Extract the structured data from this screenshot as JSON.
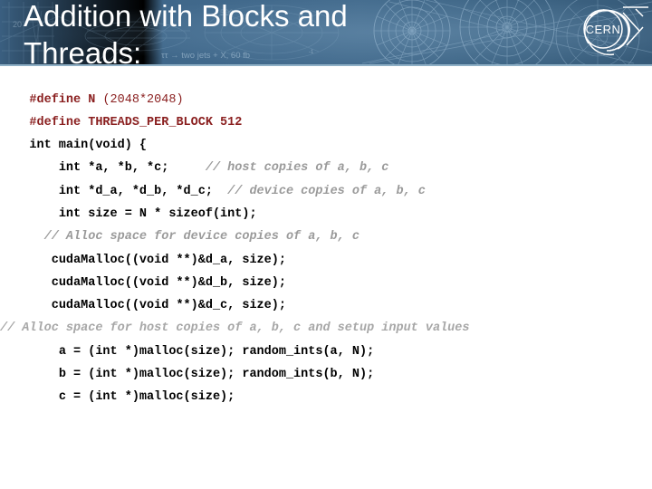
{
  "slide": {
    "title_line_1": "Addition with Blocks and",
    "title_line_2": "Threads:",
    "background_color": "#ffffff",
    "banner_color": "#3e6383",
    "banner_underline_color": "#8fb0c6",
    "title_color": "#ffffff"
  },
  "logo": {
    "name": "cern-logo",
    "text": "CERN",
    "color": "#ffffff"
  },
  "banner_art": {
    "faint_text": "ττ → two jets + X, 60 fb",
    "faint_number": "20"
  },
  "code": {
    "language": "cuda-c",
    "define_color": "#8a1f1f",
    "comment_color": "#9a9a9a",
    "keyword_color": "#000000",
    "lines": [
      {
        "id": "line-1",
        "segments": [
          {
            "text": "    ",
            "style": "plain"
          },
          {
            "text": "#define",
            "style": "red-b"
          },
          {
            "text": " ",
            "style": "plain"
          },
          {
            "text": "N",
            "style": "red-b"
          },
          {
            "text": " (2048*2048)",
            "style": "red"
          }
        ]
      },
      {
        "id": "line-2",
        "segments": [
          {
            "text": "    ",
            "style": "plain"
          },
          {
            "text": "#define",
            "style": "red-b"
          },
          {
            "text": " ",
            "style": "plain"
          },
          {
            "text": "THREADS_PER_BLOCK 512",
            "style": "red-b"
          }
        ]
      },
      {
        "id": "line-3",
        "segments": [
          {
            "text": "    ",
            "style": "plain"
          },
          {
            "text": "int main(void) {",
            "style": "kw"
          }
        ]
      },
      {
        "id": "line-4",
        "segments": [
          {
            "text": "        ",
            "style": "plain"
          },
          {
            "text": "int *a, *b, *c;",
            "style": "kw"
          },
          {
            "text": "     ",
            "style": "plain"
          },
          {
            "text": "// host copies of a, b, c",
            "style": "cmt"
          }
        ]
      },
      {
        "id": "line-5",
        "segments": [
          {
            "text": "        ",
            "style": "plain"
          },
          {
            "text": "int *d_a, *d_b, *d_c;",
            "style": "kw"
          },
          {
            "text": "  ",
            "style": "plain"
          },
          {
            "text": "// device copies of a, b, c",
            "style": "cmt"
          }
        ]
      },
      {
        "id": "line-6",
        "segments": [
          {
            "text": "        ",
            "style": "plain"
          },
          {
            "text": "int size = N * sizeof(int);",
            "style": "kw"
          }
        ]
      },
      {
        "id": "line-7",
        "segments": [
          {
            "text": "      ",
            "style": "plain"
          },
          {
            "text": "// Alloc space for device copies of a, b, c",
            "style": "cmt"
          }
        ]
      },
      {
        "id": "line-8",
        "segments": [
          {
            "text": "       ",
            "style": "plain"
          },
          {
            "text": "cudaMalloc((void **)&d_a, size);",
            "style": "kw"
          }
        ]
      },
      {
        "id": "line-9",
        "segments": [
          {
            "text": "       ",
            "style": "plain"
          },
          {
            "text": "cudaMalloc((void **)&d_b, size);",
            "style": "kw"
          }
        ]
      },
      {
        "id": "line-10",
        "segments": [
          {
            "text": "       ",
            "style": "plain"
          },
          {
            "text": "cudaMalloc((void **)&d_c, size);",
            "style": "kw"
          }
        ]
      },
      {
        "id": "line-11",
        "segments": [
          {
            "text": "",
            "style": "plain"
          },
          {
            "text": "// Alloc space for host copies of a, b, c and setup input values",
            "style": "cmt-w"
          }
        ]
      },
      {
        "id": "line-12",
        "segments": [
          {
            "text": "        ",
            "style": "plain"
          },
          {
            "text": "a = (int *)malloc(size); random_ints(a, N);",
            "style": "kw"
          }
        ]
      },
      {
        "id": "line-13",
        "segments": [
          {
            "text": "        ",
            "style": "plain"
          },
          {
            "text": "b = (int *)malloc(size); random_ints(b, N);",
            "style": "kw"
          }
        ]
      },
      {
        "id": "line-14",
        "segments": [
          {
            "text": "        ",
            "style": "plain"
          },
          {
            "text": "c = (int *)malloc(size);",
            "style": "kw"
          }
        ]
      }
    ]
  }
}
